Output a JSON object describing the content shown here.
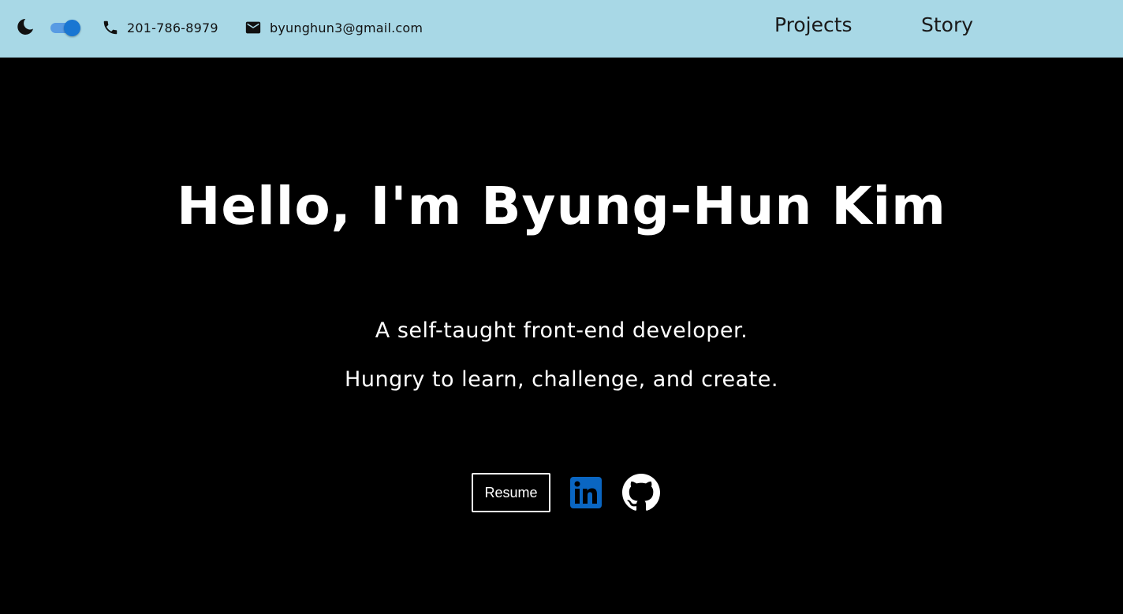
{
  "header": {
    "theme_icon": "moon-icon",
    "theme_toggle": {
      "state": "on",
      "color": "#1976d2"
    },
    "phone": {
      "icon": "phone-icon",
      "text": "201-786-8979"
    },
    "email": {
      "icon": "mail-icon",
      "text": "byunghun3@gmail.com"
    },
    "nav": [
      {
        "label": "Projects"
      },
      {
        "label": "Story"
      }
    ],
    "background": "#a8d8e6"
  },
  "hero": {
    "title": "Hello, I'm Byung-Hun Kim",
    "tagline_1": "A self-taught front-end developer.",
    "tagline_2": "Hungry to learn, challenge, and create.",
    "resume_label": "Resume",
    "linkedin_icon": "linkedin-icon",
    "github_icon": "github-icon",
    "linkedin_color": "#0a66c2",
    "background": "#000000"
  }
}
